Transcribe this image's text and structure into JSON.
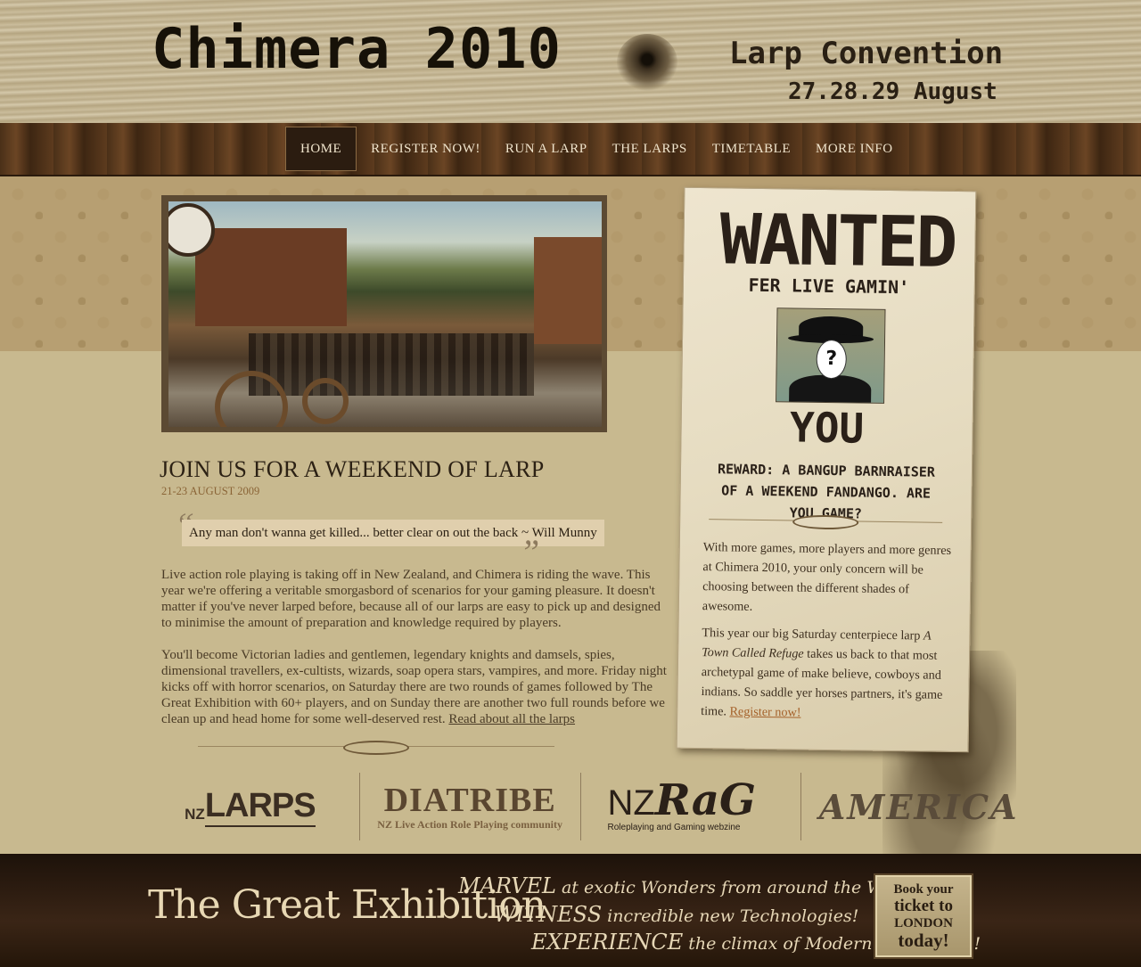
{
  "header": {
    "title": "Chimera 2010",
    "subtitle": "Larp Convention",
    "dates": "27.28.29 August"
  },
  "nav": {
    "items": [
      {
        "label": "HOME",
        "active": true
      },
      {
        "label": "REGISTER NOW!",
        "active": false
      },
      {
        "label": "RUN A LARP",
        "active": false
      },
      {
        "label": "THE LARPS",
        "active": false
      },
      {
        "label": "TIMETABLE",
        "active": false
      },
      {
        "label": "MORE INFO",
        "active": false
      }
    ]
  },
  "main": {
    "heading": "JOIN US FOR A WEEKEND OF LARP",
    "date": "21-23 AUGUST 2009",
    "quote": "Any man don't wanna get killed... better clear on out the back ~ Will Munny",
    "para1": "Live action role playing is taking off in New Zealand, and Chimera is riding the wave. This year we're offering a veritable smorgasbord of scenarios for your gaming pleasure. It doesn't matter if you've never larped before, because all of our larps are easy to pick up and designed to minimise the amount of preparation and knowledge required by players.",
    "para2": "You'll become Victorian ladies and gentlemen, legendary knights and damsels, spies, dimensional travellers, ex-cultists, wizards, soap opera stars, vampires, and more. Friday night kicks off with horror scenarios, on Saturday there are two rounds of games followed by The Great Exhibition with 60+ players, and on Sunday there are another two full rounds before we clean up and head home for some well-deserved rest.",
    "para2_link": "Read about all the larps"
  },
  "poster": {
    "title": "WANTED",
    "subtitle": "FER LIVE GAMIN'",
    "photo_glyph": "?",
    "you": "YOU",
    "reward": "REWARD: A BANGUP BARNRAISER OF A WEEKEND FANDANGO. ARE YOU GAME?",
    "para1": "With more games, more players and more genres at Chimera 2010, your only concern will be choosing between the different shades of awesome.",
    "para2_before": "This year our big Saturday centerpiece larp ",
    "para2_italic": "A Town Called Refuge",
    "para2_after": " takes us back to that most archetypal game of make believe, cowboys and indians. So saddle yer horses partners, it's game time.",
    "register_link": "Register now!"
  },
  "sponsors": {
    "nzlarps_prefix": "NZ",
    "nzlarps_name": "LARPS",
    "diatribe_name": "DIATRIBE",
    "diatribe_tagline": "NZ Live Action Role Playing community",
    "nzrag_prefix": "NZ",
    "nzrag_name": "RaG",
    "nzrag_tagline": "Roleplaying and Gaming webzine",
    "america_name": "AMERICA"
  },
  "footer": {
    "title": "The Great Exhibition",
    "line1_lead": "MARVEL",
    "line1_rest": " at exotic Wonders from around the World!",
    "line2_lead": "WITNESS",
    "line2_rest": " incredible new Technologies!",
    "line3_lead": "EXPERIENCE",
    "line3_rest": " the climax of Modern Civilisation!",
    "ticket_l1": "Book your",
    "ticket_l2": "ticket to",
    "ticket_l3": "LONDON",
    "ticket_l4": "today!"
  }
}
